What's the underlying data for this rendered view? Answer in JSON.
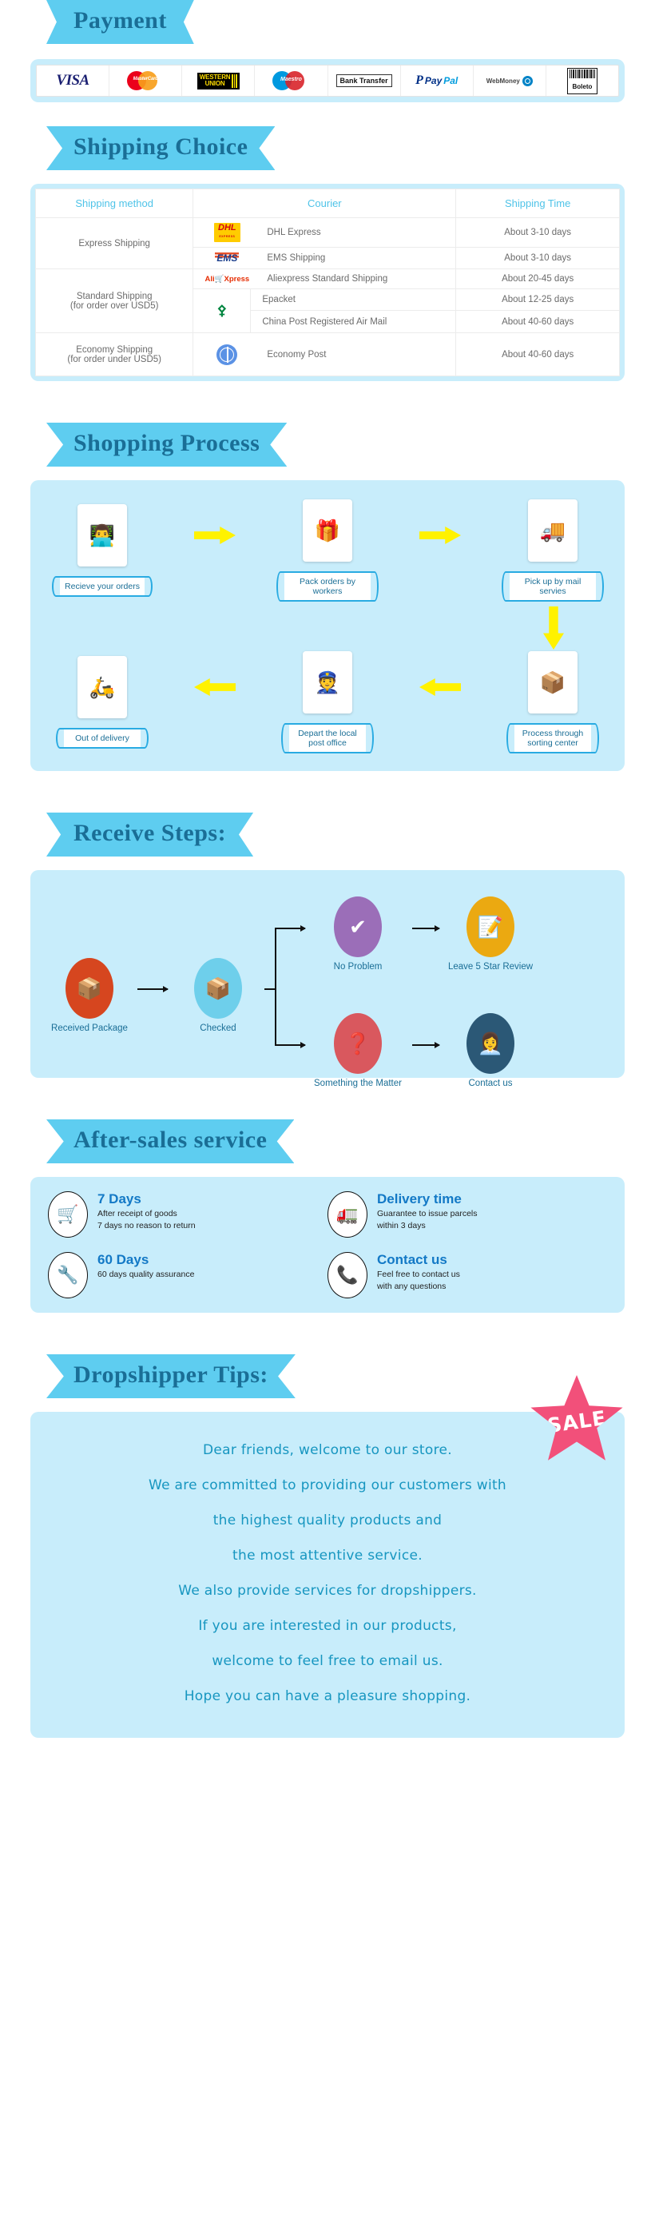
{
  "theme": {
    "banner_bg": "#5ECDF0",
    "banner_text": "#1A6E96",
    "panel_bg": "#C8EDFB",
    "accent_yellow": "#FFF200",
    "sale_pink": "#F2507A",
    "table_header": "#4EC3E8",
    "service_heading": "#1379C6"
  },
  "payment": {
    "title": "Payment",
    "methods": [
      {
        "name": "visa-logo",
        "label": "VISA"
      },
      {
        "name": "mastercard-logo",
        "label": "MasterCard"
      },
      {
        "name": "western-union-logo",
        "label": "WESTERN UNION",
        "line1": "WESTERN",
        "line2": "UNION"
      },
      {
        "name": "maestro-logo",
        "label": "Maestro"
      },
      {
        "name": "bank-transfer-logo",
        "label": "Bank Transfer"
      },
      {
        "name": "paypal-logo",
        "label": "PayPal",
        "pay": "Pay",
        "pal": "Pal"
      },
      {
        "name": "webmoney-logo",
        "label": "WebMoney"
      },
      {
        "name": "boleto-logo",
        "label": "Boleto"
      }
    ]
  },
  "shipping": {
    "title": "Shipping Choice",
    "headers": [
      "Shipping method",
      "Courier",
      "Shipping Time"
    ],
    "rows": [
      {
        "method": "Express Shipping",
        "couriers": [
          {
            "logo": "dhl-logo",
            "logo_text": "DHL",
            "logo_sub": "EXPRESS",
            "name": "DHL Express",
            "time": "About 3-10 days"
          },
          {
            "logo": "ems-logo",
            "logo_text": "EMS",
            "name": "EMS Shipping",
            "time": "About 3-10 days"
          }
        ]
      },
      {
        "method": "Standard Shipping",
        "method_sub": "(for order over USD5)",
        "couriers": [
          {
            "logo": "aliexpress-logo",
            "logo_text": "Ali",
            "logo_text2": "Xpress",
            "name": "Aliexpress Standard Shipping",
            "time": "About 20-45 days"
          }
        ],
        "grouped_logo": "china-post-logo",
        "grouped": [
          {
            "name": "Epacket",
            "time": "About 12-25  days"
          },
          {
            "name": "China Post Registered Air Mail",
            "time": "About 40-60 days"
          }
        ]
      },
      {
        "method": "Economy Shipping",
        "method_sub": "(for order under USD5)",
        "couriers": [
          {
            "logo": "united-nations-logo",
            "name": "Economy Post",
            "time": "About 40-60 days"
          }
        ]
      }
    ]
  },
  "process": {
    "title": "Shopping Process",
    "row1": [
      {
        "icon": "support-agent-icon",
        "glyph": "👨‍💻",
        "label": "Recieve your orders"
      },
      {
        "icon": "gift-box-icon",
        "glyph": "🎁",
        "label": "Pack orders by workers"
      },
      {
        "icon": "delivery-truck-icon",
        "glyph": "🚚",
        "label": "Pick up by mail servies"
      }
    ],
    "row2": [
      {
        "icon": "scooter-delivery-icon",
        "glyph": "🛵",
        "label": "Out of delivery"
      },
      {
        "icon": "postman-icon",
        "glyph": "👮",
        "label": "Depart the local\npost office",
        "label_l1": "Depart the local",
        "label_l2": "post office"
      },
      {
        "icon": "parcel-cart-icon",
        "glyph": "📦",
        "label": "Process through\nsorting center",
        "label_l1": "Process through",
        "label_l2": "sorting center"
      }
    ]
  },
  "receive": {
    "title": "Receive Steps:",
    "nodes": [
      {
        "id": "received-package",
        "icon": "package-icon",
        "glyph": "📦",
        "label": "Received Package",
        "color": "#D6461F"
      },
      {
        "id": "checked",
        "icon": "open-box-icon",
        "glyph": "📦",
        "label": "Checked",
        "color": "#6ECFEB"
      },
      {
        "id": "no-problem",
        "icon": "check-box-icon",
        "glyph": "✔",
        "label": "No Problem",
        "color": "#9B6EB8"
      },
      {
        "id": "leave-review",
        "icon": "review-paper-icon",
        "glyph": "📝",
        "label": "Leave 5 Star Review",
        "color": "#EBA911"
      },
      {
        "id": "something-matter",
        "icon": "question-box-icon",
        "glyph": "❓",
        "label": "Something the Matter",
        "color": "#D9585E"
      },
      {
        "id": "contact-us",
        "icon": "support-person-icon",
        "glyph": "👩‍💼",
        "label": "Contact us",
        "color": "#2B5876"
      }
    ]
  },
  "after_sales": {
    "title": "After-sales service",
    "items": [
      {
        "icon": "shopping-cart-icon",
        "glyph": "🛒",
        "heading": "7 Days",
        "line1": "After receipt of goods",
        "line2": "7 days no reason to return"
      },
      {
        "icon": "truck-icon",
        "glyph": "🚛",
        "heading": "Delivery time",
        "line1": "Guarantee to issue parcels",
        "line2": "within 3 days"
      },
      {
        "icon": "tools-icon",
        "glyph": "🔧",
        "heading": "60 Days",
        "line1": "60 days quality assurance",
        "line2": ""
      },
      {
        "icon": "phone-icon",
        "glyph": "📞",
        "heading": "Contact us",
        "line1": "Feel free to contact us",
        "line2": "with any questions"
      }
    ]
  },
  "tips": {
    "title": "Dropshipper Tips:",
    "badge": "SALE",
    "lines": [
      "Dear friends, welcome to our store.",
      "We are committed to providing our customers with",
      "the highest quality products and",
      "the most attentive service.",
      "We also provide services for dropshippers.",
      "If you are interested in our products,",
      "welcome to feel free to email us.",
      "Hope you can have a pleasure shopping."
    ]
  }
}
